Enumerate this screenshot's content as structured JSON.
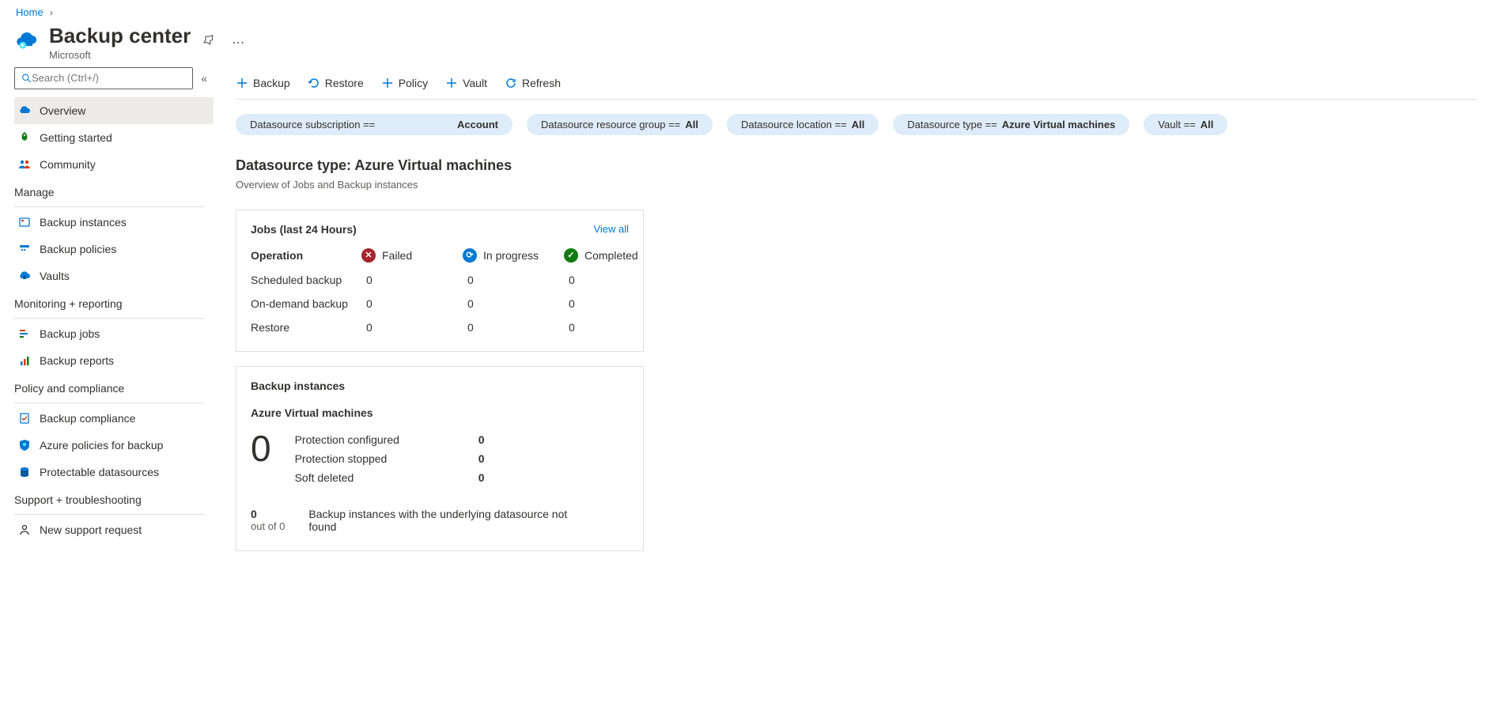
{
  "breadcrumb": {
    "home": "Home"
  },
  "header": {
    "title": "Backup center",
    "subtitle": "Microsoft"
  },
  "search": {
    "placeholder": "Search (Ctrl+/)"
  },
  "sidebar": {
    "items": [
      {
        "label": "Overview"
      },
      {
        "label": "Getting started"
      },
      {
        "label": "Community"
      }
    ],
    "manage_header": "Manage",
    "manage": [
      {
        "label": "Backup instances"
      },
      {
        "label": "Backup policies"
      },
      {
        "label": "Vaults"
      }
    ],
    "monitoring_header": "Monitoring + reporting",
    "monitoring": [
      {
        "label": "Backup jobs"
      },
      {
        "label": "Backup reports"
      }
    ],
    "policy_header": "Policy and compliance",
    "policy": [
      {
        "label": "Backup compliance"
      },
      {
        "label": "Azure policies for backup"
      },
      {
        "label": "Protectable datasources"
      }
    ],
    "support_header": "Support + troubleshooting",
    "support": [
      {
        "label": "New support request"
      }
    ]
  },
  "toolbar": {
    "backup": "Backup",
    "restore": "Restore",
    "policy": "Policy",
    "vault": "Vault",
    "refresh": "Refresh"
  },
  "filters": {
    "sub_label": "Datasource subscription ==",
    "sub_value": "Account",
    "rg_label": "Datasource resource group ==",
    "rg_value": "All",
    "loc_label": "Datasource location ==",
    "loc_value": "All",
    "type_label": "Datasource type ==",
    "type_value": "Azure Virtual machines",
    "vault_label": "Vault ==",
    "vault_value": "All"
  },
  "section": {
    "title": "Datasource type: Azure Virtual machines",
    "desc": "Overview of Jobs and Backup instances"
  },
  "jobs": {
    "title": "Jobs (last 24 Hours)",
    "view_all": "View all",
    "operation_label": "Operation",
    "failed_label": "Failed",
    "inprogress_label": "In progress",
    "completed_label": "Completed",
    "rows": [
      {
        "op": "Scheduled backup",
        "failed": "0",
        "inprogress": "0",
        "completed": "0"
      },
      {
        "op": "On-demand backup",
        "failed": "0",
        "inprogress": "0",
        "completed": "0"
      },
      {
        "op": "Restore",
        "failed": "0",
        "inprogress": "0",
        "completed": "0"
      }
    ]
  },
  "bi": {
    "title": "Backup instances",
    "subtitle": "Azure Virtual machines",
    "big": "0",
    "rows": [
      {
        "label": "Protection configured",
        "val": "0"
      },
      {
        "label": "Protection stopped",
        "val": "0"
      },
      {
        "label": "Soft deleted",
        "val": "0"
      }
    ],
    "footer_num": "0",
    "footer_sub": "out of 0",
    "footer_text": "Backup instances with the underlying datasource not found"
  }
}
